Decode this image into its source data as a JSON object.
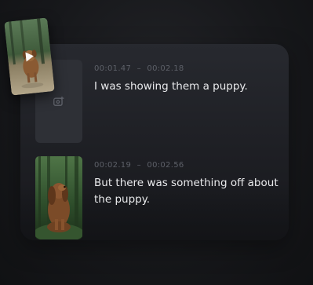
{
  "cues": [
    {
      "start": "00:01.47",
      "separator": "–",
      "end": "00:02.18",
      "text": "I was showing them a puppy."
    },
    {
      "start": "00:02.19",
      "separator": "–",
      "end": "00:02.56",
      "text": "But there was something off about the puppy."
    }
  ],
  "icons": {
    "placeholder": "add-media-icon",
    "drag_thumbnail_overlay": "play-icon"
  },
  "colors": {
    "background": "#141518",
    "card": "#25272c",
    "timecode": "#5d6068",
    "text": "#e9eaec",
    "placeholder": "#2e3036"
  }
}
